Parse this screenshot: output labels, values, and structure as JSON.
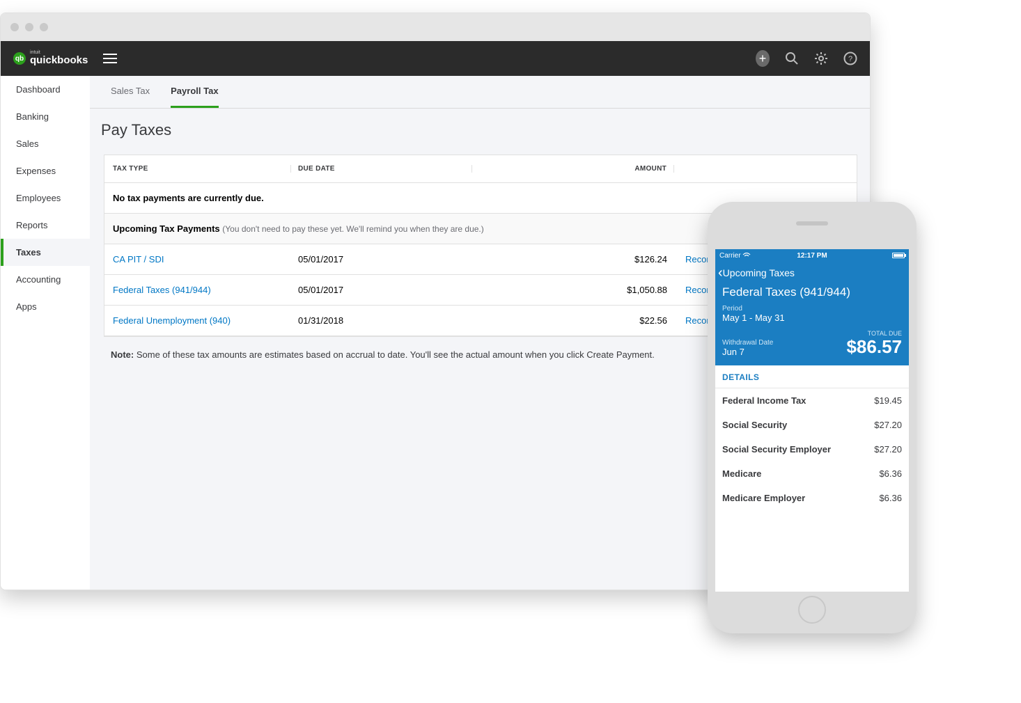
{
  "brand": {
    "name": "quickbooks",
    "small": "intuit",
    "badge": "qb"
  },
  "sidebar": {
    "items": [
      {
        "label": "Dashboard"
      },
      {
        "label": "Banking"
      },
      {
        "label": "Sales"
      },
      {
        "label": "Expenses"
      },
      {
        "label": "Employees"
      },
      {
        "label": "Reports"
      },
      {
        "label": "Taxes"
      },
      {
        "label": "Accounting"
      },
      {
        "label": "Apps"
      }
    ],
    "active_index": 6
  },
  "tabs": [
    {
      "label": "Sales Tax"
    },
    {
      "label": "Payroll Tax"
    }
  ],
  "tabs_active_index": 1,
  "page_title": "Pay Taxes",
  "table": {
    "headers": {
      "type": "TAX TYPE",
      "due": "DUE DATE",
      "amount": "AMOUNT"
    },
    "no_due_msg": "No tax payments are currently due.",
    "upcoming_label": "Upcoming Tax Payments",
    "upcoming_hint": "(You don't need to pay these yet. We'll remind you when they are due.)",
    "rows": [
      {
        "type": "CA PIT / SDI",
        "due": "05/01/2017",
        "amount": "$126.24",
        "action": "Record p"
      },
      {
        "type": "Federal Taxes (941/944)",
        "due": "05/01/2017",
        "amount": "$1,050.88",
        "action": "Record p"
      },
      {
        "type": "Federal Unemployment (940)",
        "due": "01/31/2018",
        "amount": "$22.56",
        "action": "Record p"
      }
    ]
  },
  "note": {
    "label": "Note:",
    "text": "Some of these tax amounts are estimates based on accrual to date. You'll see the actual amount when you click Create Payment."
  },
  "phone": {
    "status": {
      "carrier": "Carrier",
      "time": "12:17 PM"
    },
    "back_label": "Upcoming Taxes",
    "title": "Federal Taxes (941/944)",
    "period_label": "Period",
    "period_value": "May 1 - May 31",
    "withdrawal_label": "Withdrawal Date",
    "withdrawal_value": "Jun 7",
    "total_label": "TOTAL DUE",
    "total_value": "$86.57",
    "details_header": "DETAILS",
    "lines": [
      {
        "label": "Federal Income Tax",
        "amount": "$19.45"
      },
      {
        "label": "Social Security",
        "amount": "$27.20"
      },
      {
        "label": "Social Security Employer",
        "amount": "$27.20"
      },
      {
        "label": "Medicare",
        "amount": "$6.36"
      },
      {
        "label": "Medicare Employer",
        "amount": "$6.36"
      }
    ]
  }
}
